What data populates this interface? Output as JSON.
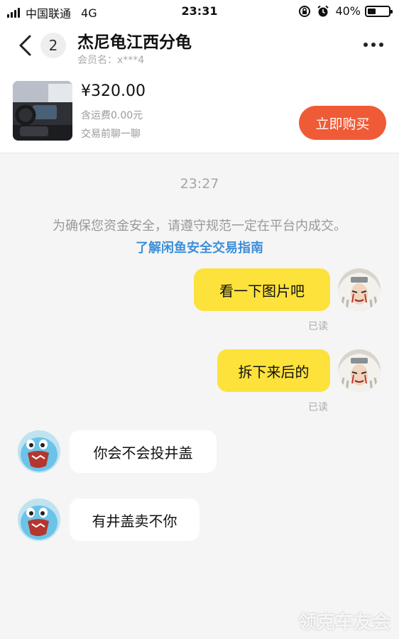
{
  "status_bar": {
    "carrier": "中国联通",
    "network": "4G",
    "time": "23:31",
    "battery": "40%",
    "battery_level": 0.4
  },
  "header": {
    "unread_count": "2",
    "title": "杰尼龟江西分龟",
    "member_label": "会员名：x***4"
  },
  "product": {
    "price": "¥320.00",
    "shipping": "含运费0.00元",
    "chat_hint": "交易前聊一聊",
    "buy_label": "立即购买"
  },
  "chat": {
    "timestamp": "23:27",
    "notice": "为确保您资金安全，请遵守规范一定在平台内成交。",
    "guide_link": "了解闲鱼安全交易指南",
    "messages": [
      {
        "from": "me",
        "text": "看一下图片吧",
        "status": "已读"
      },
      {
        "from": "me",
        "text": "拆下来后的",
        "status": "已读"
      },
      {
        "from": "them",
        "text": "你会不会投井盖"
      },
      {
        "from": "them",
        "text": "有井盖卖不你"
      }
    ]
  },
  "watermark": "领克车友会",
  "colors": {
    "accent_buy": "#ef5b36",
    "my_bubble": "#fde23b",
    "link": "#3d8ed8"
  }
}
